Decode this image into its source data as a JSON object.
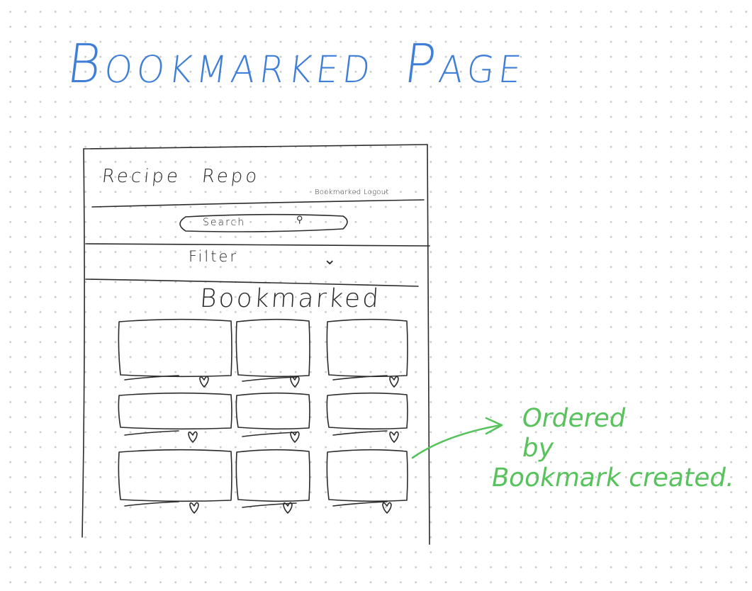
{
  "title": {
    "word1": "Bookmarked",
    "word2": "Page"
  },
  "wireframe": {
    "header": {
      "app_name_1": "Recipe",
      "app_name_2": "Repo",
      "nav_links": "Bookmarked Logout"
    },
    "search": {
      "label": "Search",
      "icon": "search-icon"
    },
    "filter": {
      "label": "Filter",
      "icon": "chevron-down-icon"
    },
    "section_heading": "Bookmarked",
    "cards": {
      "rows": 3,
      "columns": 3,
      "icon": "heart-icon"
    }
  },
  "annotation": {
    "line1": "Ordered",
    "line2": "by",
    "line3": "Bookmark created.",
    "color": "#58c35d"
  },
  "colors": {
    "title": "#3f7fd8",
    "ink": "#2b2b2b",
    "annotation": "#58c35d"
  }
}
